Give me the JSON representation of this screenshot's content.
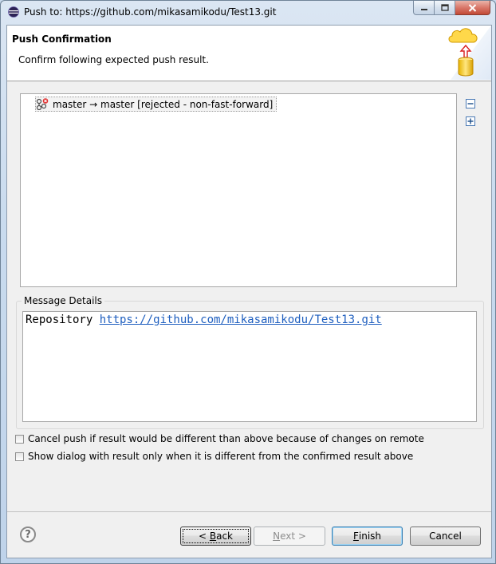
{
  "window": {
    "title": "Push to: https://github.com/mikasamikodu/Test13.git",
    "controls": [
      "minimize",
      "maximize",
      "close"
    ]
  },
  "header": {
    "title": "Push Confirmation",
    "description": "Confirm following expected push result.",
    "banner_icon": "push-to-cloud-icon"
  },
  "result_tree": {
    "items": [
      {
        "label": "master → master [rejected - non-fast-forward]",
        "icon": "rejected-push-icon"
      }
    ],
    "collapse_all_icon": "collapse-all-icon",
    "expand_all_icon": "expand-all-icon"
  },
  "message_details": {
    "label": "Message Details",
    "prefix": "Repository ",
    "link": "https://github.com/mikasamikodu/Test13.git"
  },
  "options": [
    {
      "label": "Cancel push if result would be different than above because of changes on remote",
      "checked": false
    },
    {
      "label": "Show dialog with result only when it is different from the confirmed result above",
      "checked": false
    }
  ],
  "buttons": {
    "help": "?",
    "back_pre": "< ",
    "back_mnemonic": "B",
    "back_rest": "ack",
    "next_mnemonic": "N",
    "next_rest": "ext >",
    "finish_mnemonic": "F",
    "finish_rest": "inish",
    "cancel": "Cancel"
  },
  "colors": {
    "link": "#1f5fbf",
    "close_button": "#c24a36"
  }
}
